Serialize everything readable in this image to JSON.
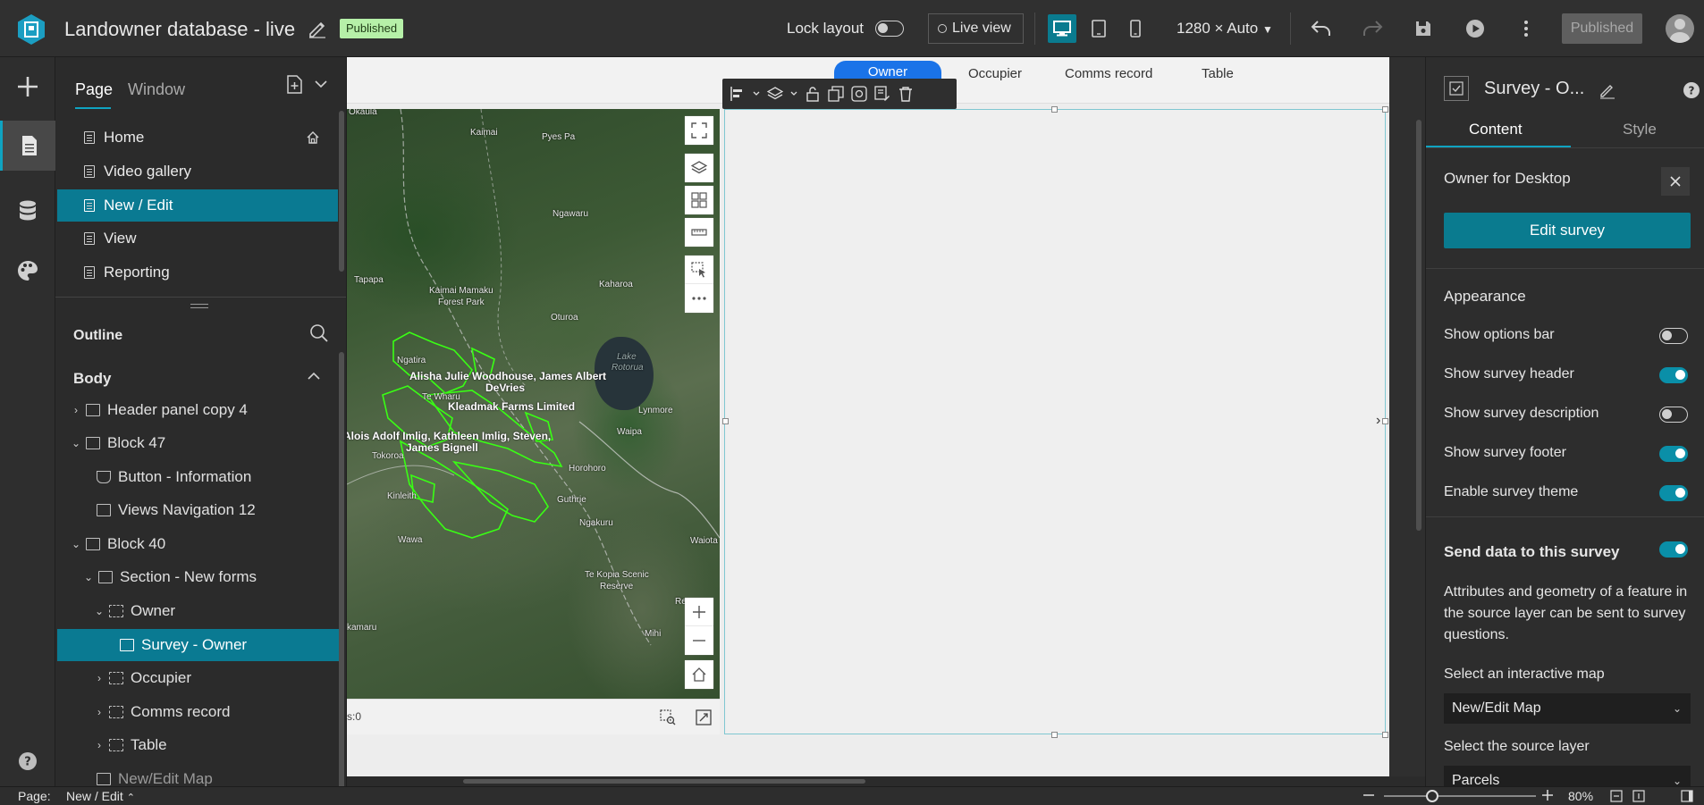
{
  "header": {
    "app_title": "Landowner database - live",
    "status_badge": "Published",
    "lock_layout_label": "Lock layout",
    "live_view_label": "Live view",
    "resolution": "1280 × Auto",
    "publish_button": "Published"
  },
  "page_panel": {
    "tabs": [
      "Page",
      "Window"
    ],
    "pages": [
      "Home",
      "Video gallery",
      "New / Edit",
      "View",
      "Reporting"
    ],
    "selected_page": "New / Edit",
    "outline_label": "Outline",
    "body_label": "Body",
    "tree": [
      {
        "label": "Header panel copy 4"
      },
      {
        "label": "Block 47"
      },
      {
        "label": "Button - Information"
      },
      {
        "label": "Views Navigation 12"
      },
      {
        "label": "Block 40"
      },
      {
        "label": "Section - New forms"
      },
      {
        "label": "Owner"
      },
      {
        "label": "Survey - Owner"
      },
      {
        "label": "Occupier"
      },
      {
        "label": "Comms record"
      },
      {
        "label": "Table"
      },
      {
        "label": "New/Edit Map"
      }
    ]
  },
  "canvas": {
    "nav_tabs": [
      "Owner",
      "Occupier",
      "Comms record",
      "Table"
    ],
    "map_places": [
      "Okaula",
      "Kaimai",
      "Pyes Pa",
      "Ngawaru",
      "Tapapa",
      "Kaimai Mamaku",
      "Forest Park",
      "Kaharoa",
      "Oturoa",
      "Lake",
      "Rotorua",
      "Ngatira",
      "Lynmore",
      "Waipa",
      "Tokoroa",
      "Horohoro",
      "Kinleith",
      "Guthrie",
      "Ngakuru",
      "Wawa",
      "Te Kopia Scenic",
      "Reserve",
      "Waiota",
      "Reporoa",
      "Mihi",
      "kamaru",
      "Te Wharu"
    ],
    "parcel_labels": [
      "Alisha Julie Woodhouse, James Albert",
      "DeVries",
      "Kleadmak Farms Limited",
      "Alois Adolf Imlig, Kathleen Imlig, Steven,",
      "James Bignell"
    ],
    "map_footer_text": "s:0"
  },
  "right_panel": {
    "widget_title": "Survey - O...",
    "tabs": [
      "Content",
      "Style"
    ],
    "section_title": "Owner for Desktop",
    "edit_survey_button": "Edit survey",
    "appearance_label": "Appearance",
    "options": [
      {
        "label": "Show options bar",
        "on": false
      },
      {
        "label": "Show survey header",
        "on": true
      },
      {
        "label": "Show survey description",
        "on": false
      },
      {
        "label": "Show survey footer",
        "on": true
      },
      {
        "label": "Enable survey theme",
        "on": true
      }
    ],
    "send_data_label": "Send data to this survey",
    "send_data_on": true,
    "send_data_desc": "Attributes and geometry of a feature in the source layer can be sent to survey questions.",
    "select_map_label": "Select an interactive map",
    "select_map_value": "New/Edit Map",
    "select_layer_label": "Select the source layer",
    "select_layer_value": "Parcels"
  },
  "status_bar": {
    "page_label": "Page:",
    "page_value": "New / Edit",
    "zoom": "80%"
  },
  "colors": {
    "accent": "#0a7b8f",
    "badge": "#b6f0a8",
    "parcel_outline": "#39ff14"
  }
}
